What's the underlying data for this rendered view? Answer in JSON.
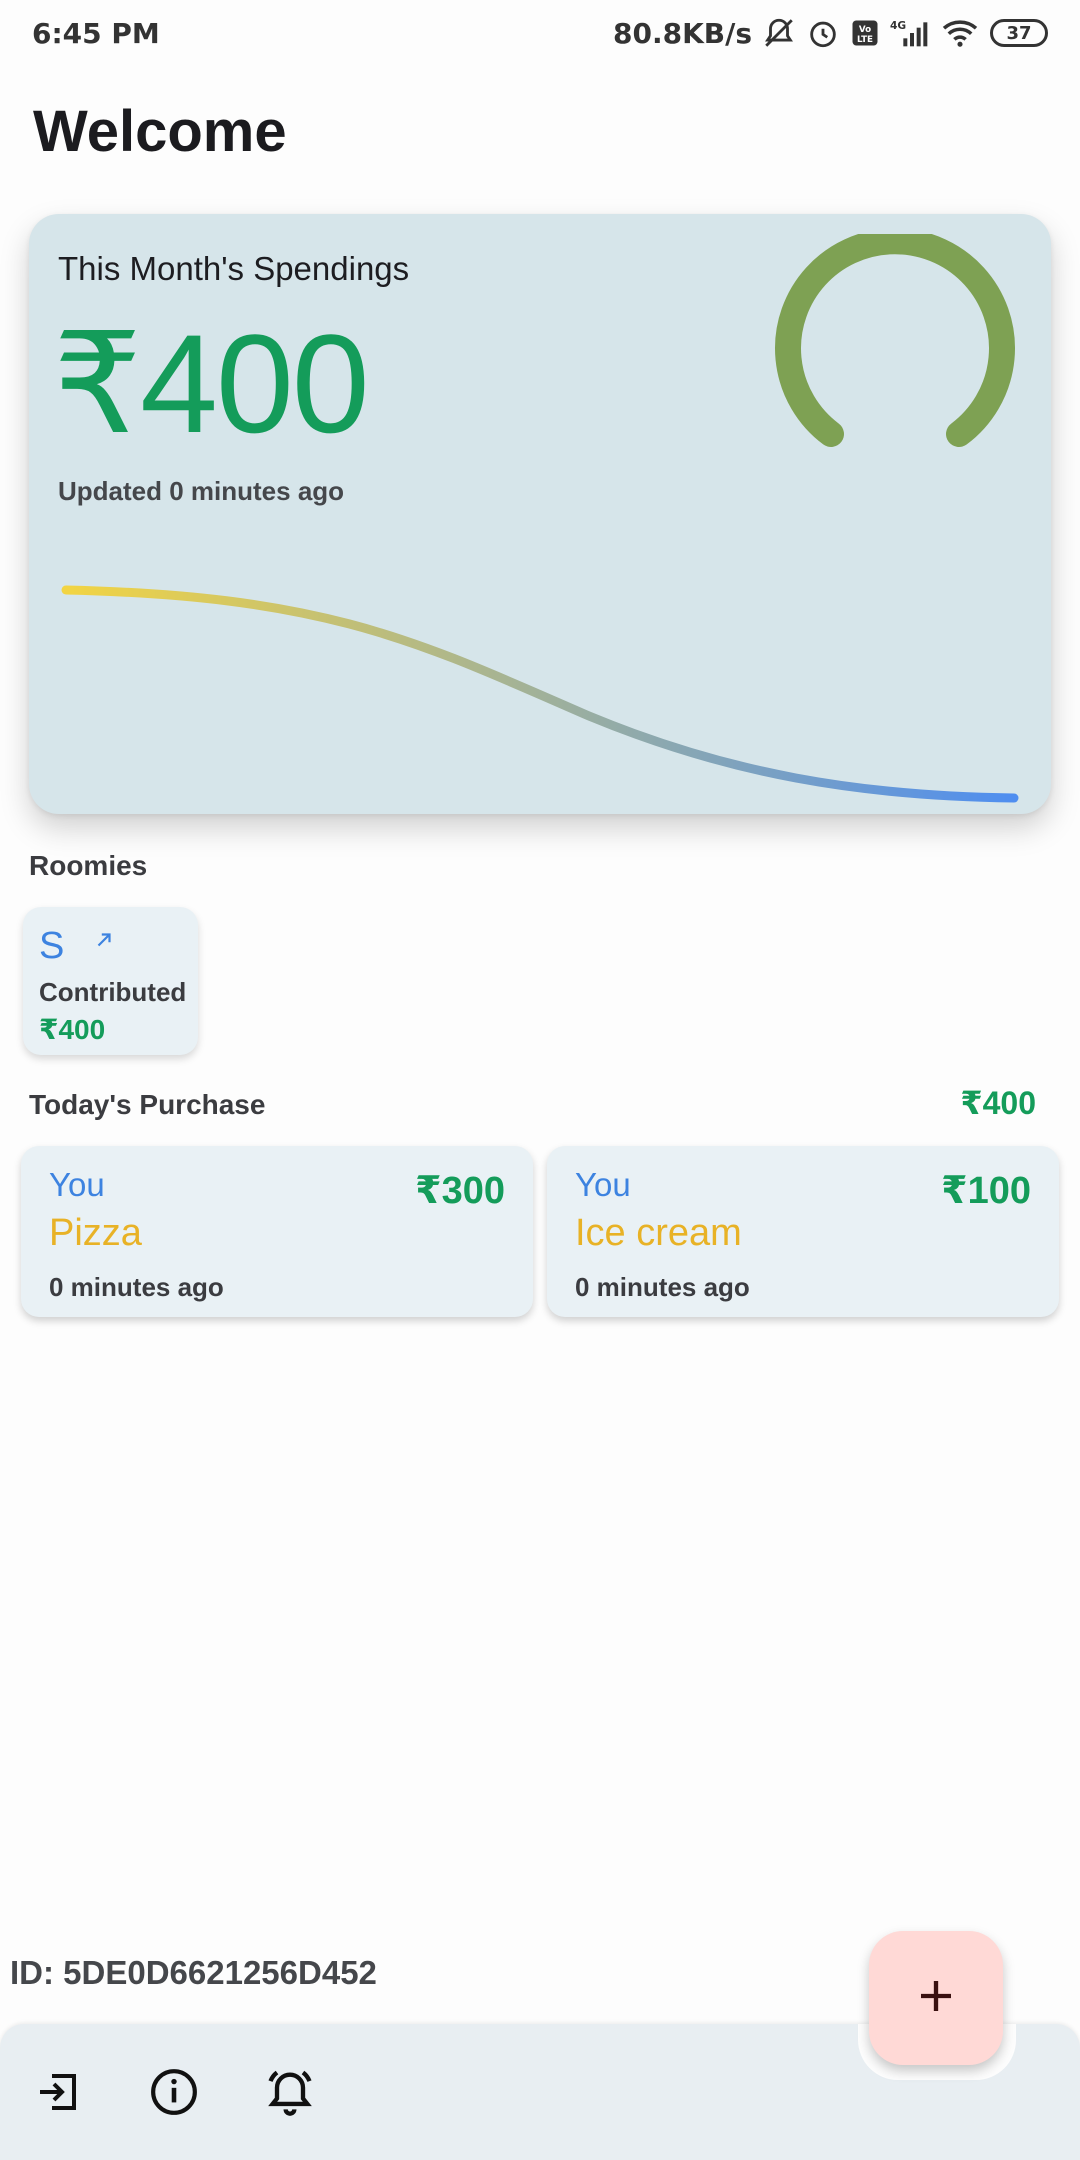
{
  "status_bar": {
    "time": "6:45 PM",
    "network_speed": "80.8KB/s",
    "battery": "37",
    "icons": [
      "muted-bell-icon",
      "alarm-icon",
      "volte-icon",
      "signal-icon",
      "wifi-icon",
      "battery-icon"
    ]
  },
  "page": {
    "title": "Welcome"
  },
  "spendings": {
    "title": "This Month's Spendings",
    "amount": "₹400",
    "updated": "Updated 0 minutes ago",
    "colors": {
      "amount": "#149c5a",
      "gauge": "#7ea153",
      "trend_start": "#f2d443",
      "trend_end": "#4f8ef0"
    }
  },
  "roomies": {
    "label": "Roomies",
    "items": [
      {
        "initial": "S",
        "contributed_label": "Contributed",
        "amount": "₹400"
      }
    ]
  },
  "purchases": {
    "label": "Today's Purchase",
    "total": "₹400",
    "items": [
      {
        "user": "You",
        "amount": "₹300",
        "item": "Pizza",
        "time": "0 minutes ago"
      },
      {
        "user": "You",
        "amount": "₹100",
        "item": "Ice cream",
        "time": "0 minutes ago"
      }
    ]
  },
  "footer": {
    "room_id": "ID: 5DE0D6621256D452",
    "nav_icons": [
      "logout-icon",
      "info-icon",
      "alarm-bell-icon"
    ],
    "fab_icon": "plus-icon"
  }
}
